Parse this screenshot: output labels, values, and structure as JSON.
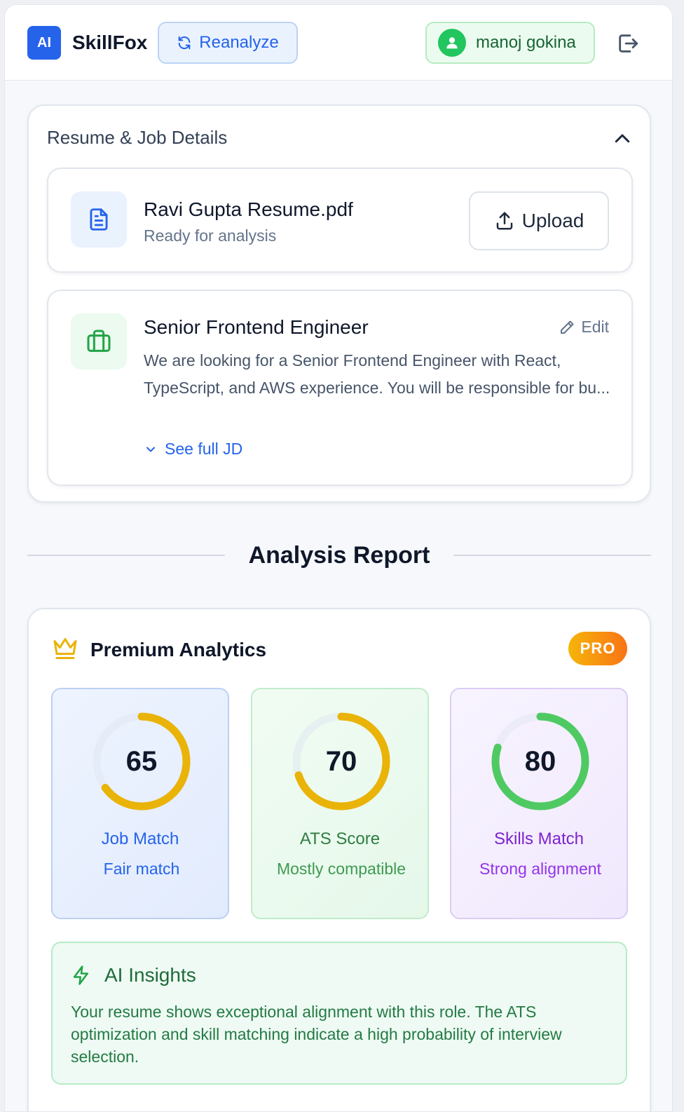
{
  "header": {
    "logo_text": "AI",
    "brand": "SkillFox",
    "reanalyze_label": "Reanalyze",
    "user_name": "manoj gokina",
    "icons": [
      "refresh-icon",
      "user-icon",
      "logout-icon"
    ]
  },
  "details": {
    "title": "Resume & Job Details",
    "resume": {
      "file_name": "Ravi Gupta Resume.pdf",
      "status": "Ready for analysis",
      "upload_label": "Upload"
    },
    "job": {
      "title": "Senior Frontend Engineer",
      "edit_label": "Edit",
      "description": "We are looking for a Senior Frontend Engineer with React, TypeScript, and AWS experience. You will be responsible for bu...",
      "see_full_label": "See full JD"
    }
  },
  "report": {
    "heading": "Analysis Report",
    "premium_title": "Premium Analytics",
    "badge": "PRO",
    "metrics": [
      {
        "value": "65",
        "label": "Job Match",
        "sub": "Fair match",
        "ring_color": "#eab308",
        "fraction": 0.65
      },
      {
        "value": "70",
        "label": "ATS Score",
        "sub": "Mostly compatible",
        "ring_color": "#eab308",
        "fraction": 0.7
      },
      {
        "value": "80",
        "label": "Skills Match",
        "sub": "Strong alignment",
        "ring_color": "#4fca63",
        "fraction": 0.8
      }
    ],
    "insights": {
      "title": "AI Insights",
      "text": "Your resume shows exceptional alignment with this role. The ATS optimization and skill matching indicate a high probability of interview selection."
    }
  },
  "colors": {
    "accent": "#2563eb",
    "success": "#22c55e",
    "warning": "#eab308"
  }
}
